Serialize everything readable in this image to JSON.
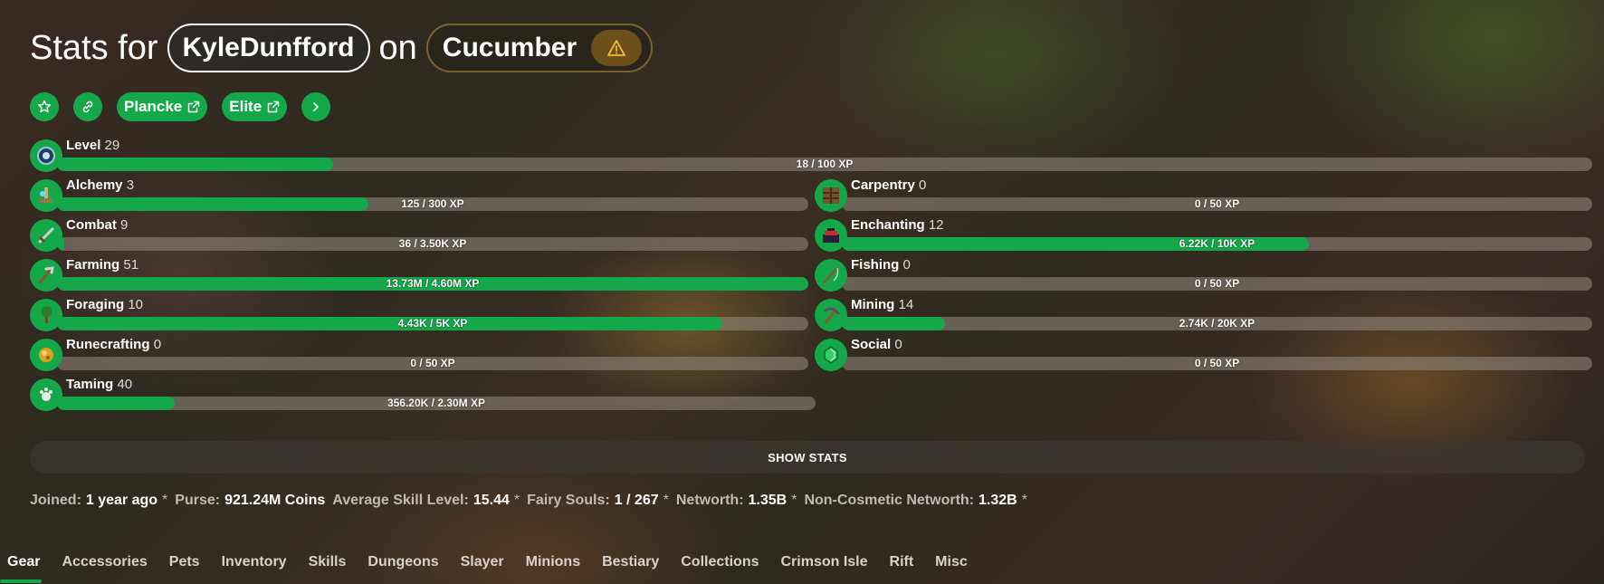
{
  "header": {
    "prefix": "Stats for",
    "player": "KyleDunfford",
    "on": "on",
    "profile": "Cucumber"
  },
  "actions": {
    "plancke": "Plancke",
    "elite": "Elite"
  },
  "skills": {
    "level": {
      "name": "Level",
      "level": "29",
      "xp": "18 / 100 XP",
      "progress": 0.18
    },
    "alchemy": {
      "name": "Alchemy",
      "level": "3",
      "xp": "125 / 300 XP",
      "progress": 0.415
    },
    "carpentry": {
      "name": "Carpentry",
      "level": "0",
      "xp": "0 / 50 XP",
      "progress": 0.0
    },
    "combat": {
      "name": "Combat",
      "level": "9",
      "xp": "36 / 3.50K XP",
      "progress": 0.01
    },
    "enchanting": {
      "name": "Enchanting",
      "level": "12",
      "xp": "6.22K / 10K XP",
      "progress": 0.622
    },
    "farming": {
      "name": "Farming",
      "level": "51",
      "xp": "13.73M / 4.60M XP",
      "progress": 1.0
    },
    "fishing": {
      "name": "Fishing",
      "level": "0",
      "xp": "0 / 50 XP",
      "progress": 0.0
    },
    "foraging": {
      "name": "Foraging",
      "level": "10",
      "xp": "4.43K / 5K XP",
      "progress": 0.886
    },
    "mining": {
      "name": "Mining",
      "level": "14",
      "xp": "2.74K / 20K XP",
      "progress": 0.137
    },
    "runecrafting": {
      "name": "Runecrafting",
      "level": "0",
      "xp": "0 / 50 XP",
      "progress": 0.0
    },
    "social": {
      "name": "Social",
      "level": "0",
      "xp": "0 / 50 XP",
      "progress": 0.0
    },
    "taming": {
      "name": "Taming",
      "level": "40",
      "xp": "356.20K / 2.30M XP",
      "progress": 0.155
    }
  },
  "show_stats": "SHOW STATS",
  "info": {
    "joined_k": "Joined:",
    "joined_v": "1 year ago",
    "purse_k": "Purse:",
    "purse_v": "921.24M Coins",
    "avg_k": "Average Skill Level:",
    "avg_v": "15.44",
    "fairy_k": "Fairy Souls:",
    "fairy_v": "1 / 267",
    "net_k": "Networth:",
    "net_v": "1.35B",
    "noncos_k": "Non-Cosmetic Networth:",
    "noncos_v": "1.32B",
    "asterisk": "*"
  },
  "tabs": [
    "Gear",
    "Accessories",
    "Pets",
    "Inventory",
    "Skills",
    "Dungeons",
    "Slayer",
    "Minions",
    "Bestiary",
    "Collections",
    "Crimson Isle",
    "Rift",
    "Misc"
  ],
  "colors": {
    "accent": "#15a84a",
    "warning": "#f5b82e"
  }
}
